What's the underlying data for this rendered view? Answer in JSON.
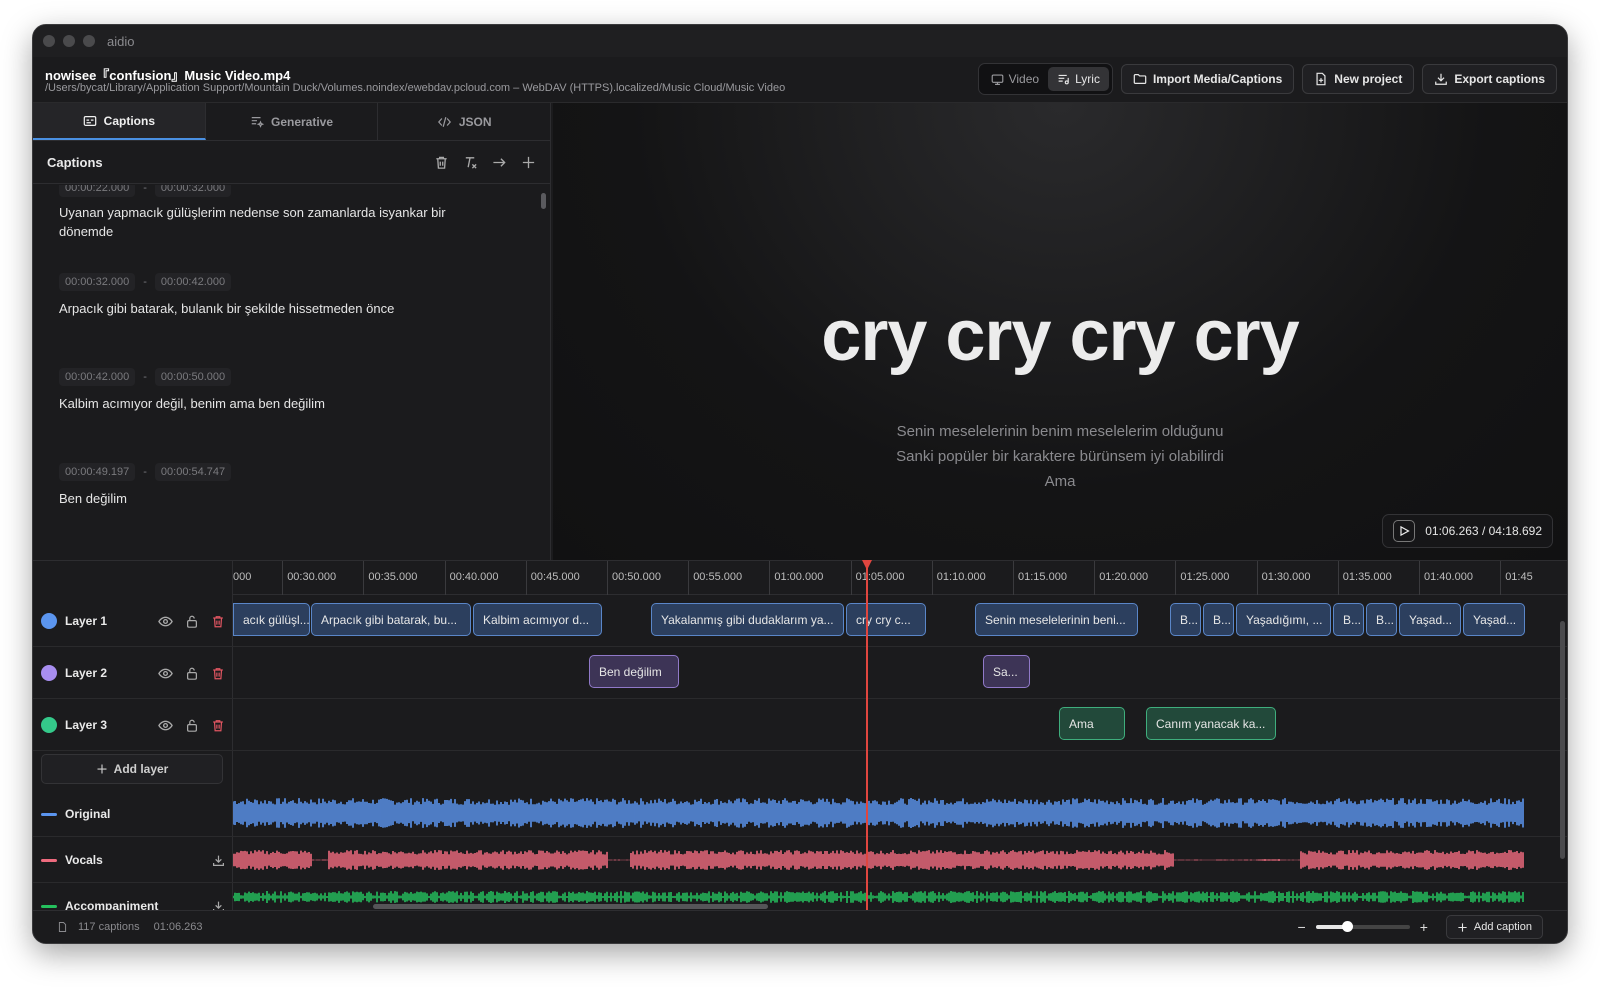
{
  "app": {
    "name": "aidio"
  },
  "header": {
    "file_title": "nowisee『confusion』Music Video.mp4",
    "file_path": "/Users/bycat/Library/Application Support/Mountain Duck/Volumes.noindex/ewebdav.pcloud.com – WebDAV (HTTPS).localized/Music Cloud/Music Video",
    "view_toggle": {
      "video": "Video",
      "lyric": "Lyric",
      "active": "lyric"
    },
    "import_label": "Import Media/Captions",
    "new_project_label": "New project",
    "export_label": "Export captions"
  },
  "left_tabs": [
    {
      "label": "Captions",
      "icon": "captions-icon",
      "active": true
    },
    {
      "label": "Generative",
      "icon": "generative-icon",
      "active": false
    },
    {
      "label": "JSON",
      "icon": "code-icon",
      "active": false
    }
  ],
  "captions_panel": {
    "title": "Captions",
    "tools": [
      "trash-icon",
      "clear-format-icon",
      "arrow-right-icon",
      "plus-icon"
    ],
    "items": [
      {
        "start": "00:00:22.000",
        "end": "00:00:32.000",
        "text": "Uyanan yapmacık gülüşlerim nedense son zamanlarda isyankar bir dönemde"
      },
      {
        "start": "00:00:32.000",
        "end": "00:00:42.000",
        "text": "Arpacık gibi batarak, bulanık bir şekilde hissetmeden önce"
      },
      {
        "start": "00:00:42.000",
        "end": "00:00:50.000",
        "text": "Kalbim acımıyor değil, benim ama ben değilim"
      },
      {
        "start": "00:00:49.197",
        "end": "00:00:54.747",
        "text": "Ben değilim"
      }
    ],
    "separator": "-"
  },
  "preview": {
    "main_lyric": "cry cry cry cry",
    "sub_lines": [
      "Senin meselelerinin benim meselelerim olduğunu",
      "Sanki popüler bir karaktere bürünsem iyi olabilirdi",
      "Ama"
    ],
    "time_current": "01:06.263",
    "time_total": "04:18.692",
    "time_display": "01:06.263 / 04:18.692"
  },
  "timeline": {
    "ruler": [
      "000",
      "00:30.000",
      "00:35.000",
      "00:40.000",
      "00:45.000",
      "00:50.000",
      "00:55.000",
      "01:00.000",
      "01:05.000",
      "01:10.000",
      "01:15.000",
      "01:20.000",
      "01:25.000",
      "01:30.000",
      "01:35.000",
      "01:40.000",
      "01:45"
    ],
    "layers": [
      {
        "name": "Layer 1",
        "color": "#5b95ef",
        "clips": [
          "acık gülüşl...",
          "Arpacık gibi batarak, bu...",
          "Kalbim acımıyor d...",
          "Yakalanmış gibi dudaklarım ya...",
          "cry cry c...",
          "Senin meselelerinin beni...",
          "B...",
          "B...",
          "Yaşadığımı, ...",
          "B...",
          "B...",
          "Yaşad...",
          "Yaşad..."
        ]
      },
      {
        "name": "Layer 2",
        "color": "#a88ef0",
        "clips": [
          "Ben değilim",
          "Sa..."
        ]
      },
      {
        "name": "Layer 3",
        "color": "#34c98a",
        "clips": [
          "Ama",
          "Canım yanacak ka..."
        ]
      }
    ],
    "add_layer_label": "Add layer",
    "tracks": [
      {
        "name": "Original",
        "color": "#5b95ef"
      },
      {
        "name": "Vocals",
        "color": "#ee6b7e"
      },
      {
        "name": "Accompaniment",
        "color": "#25c05d"
      }
    ]
  },
  "statusbar": {
    "caption_count": "117 captions",
    "time": "01:06.263",
    "zoom_level": 0.33,
    "add_caption_label": "Add caption"
  }
}
